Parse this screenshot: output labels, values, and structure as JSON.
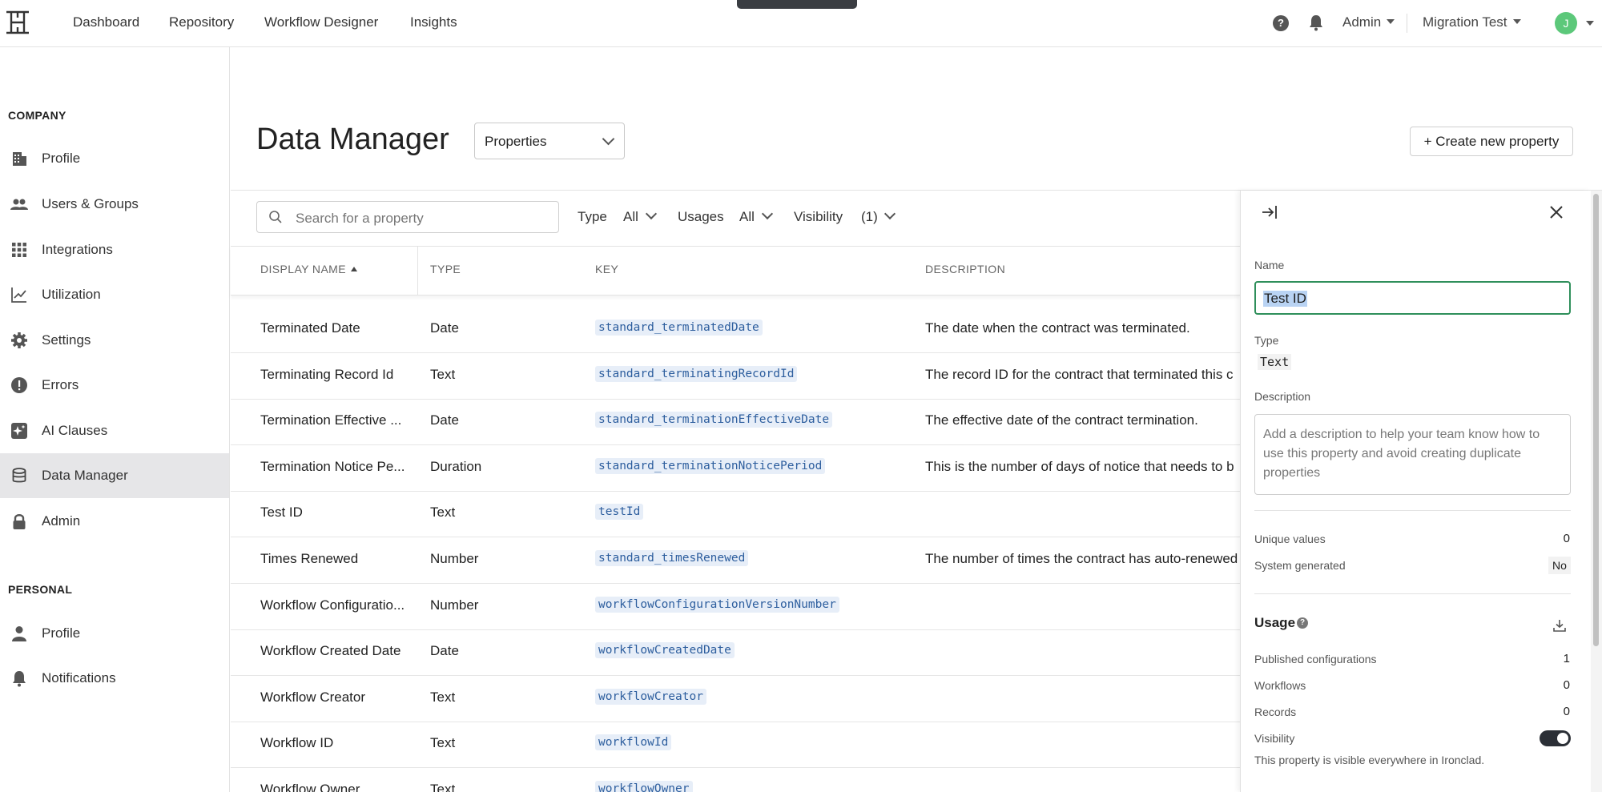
{
  "topnav": {
    "links": [
      "Dashboard",
      "Repository",
      "Workflow Designer",
      "Insights"
    ],
    "help_icon": "?",
    "admin_label": "Admin",
    "workspace_label": "Migration Test",
    "avatar_initial": "J"
  },
  "sidebar": {
    "company_title": "COMPANY",
    "company_items": [
      {
        "label": "Profile",
        "icon": "building-icon"
      },
      {
        "label": "Users & Groups",
        "icon": "users-icon"
      },
      {
        "label": "Integrations",
        "icon": "grid-icon"
      },
      {
        "label": "Utilization",
        "icon": "chart-line-icon"
      },
      {
        "label": "Settings",
        "icon": "gear-icon"
      },
      {
        "label": "Errors",
        "icon": "alert-circle-icon"
      },
      {
        "label": "AI Clauses",
        "icon": "sparkle-icon"
      },
      {
        "label": "Data Manager",
        "icon": "database-icon",
        "active": true
      },
      {
        "label": "Admin",
        "icon": "lock-icon"
      }
    ],
    "personal_title": "PERSONAL",
    "personal_items": [
      {
        "label": "Profile",
        "icon": "person-icon"
      },
      {
        "label": "Notifications",
        "icon": "bell-icon"
      }
    ]
  },
  "main": {
    "title": "Data Manager",
    "view_select": "Properties",
    "create_button": "+ Create new property",
    "search_placeholder": "Search for a property",
    "filters": {
      "type_label": "Type",
      "type_value": "All",
      "usages_label": "Usages",
      "usages_value": "All",
      "visibility_label": "Visibility",
      "visibility_value": "(1)"
    },
    "columns": [
      "DISPLAY NAME",
      "TYPE",
      "KEY",
      "DESCRIPTION"
    ],
    "rows": [
      {
        "name": "Terminated Date",
        "type": "Date",
        "key": "standard_terminatedDate",
        "description": "The date when the contract was terminated."
      },
      {
        "name": "Terminating Record Id",
        "type": "Text",
        "key": "standard_terminatingRecordId",
        "description": "The record ID for the contract that terminated this c"
      },
      {
        "name": "Termination Effective ...",
        "type": "Date",
        "key": "standard_terminationEffectiveDate",
        "description": "The effective date of the contract termination."
      },
      {
        "name": "Termination Notice Pe...",
        "type": "Duration",
        "key": "standard_terminationNoticePeriod",
        "description": "This is the number of days of notice that needs to b"
      },
      {
        "name": "Test ID",
        "type": "Text",
        "key": "testId",
        "description": ""
      },
      {
        "name": "Times Renewed",
        "type": "Number",
        "key": "standard_timesRenewed",
        "description": "The number of times the contract has auto-renewed"
      },
      {
        "name": "Workflow Configuratio...",
        "type": "Number",
        "key": "workflowConfigurationVersionNumber",
        "description": ""
      },
      {
        "name": "Workflow Created Date",
        "type": "Date",
        "key": "workflowCreatedDate",
        "description": ""
      },
      {
        "name": "Workflow Creator",
        "type": "Text",
        "key": "workflowCreator",
        "description": ""
      },
      {
        "name": "Workflow ID",
        "type": "Text",
        "key": "workflowId",
        "description": ""
      },
      {
        "name": "Workflow Owner",
        "type": "Text",
        "key": "workflowOwner",
        "description": ""
      }
    ]
  },
  "panel": {
    "name_label": "Name",
    "name_value": "Test ID",
    "type_label": "Type",
    "type_value": "Text",
    "description_label": "Description",
    "description_placeholder": "Add a description to help your team know how to use this property and avoid creating duplicate properties",
    "unique_values_label": "Unique values",
    "unique_values": "0",
    "system_generated_label": "System generated",
    "system_generated": "No",
    "usage_title": "Usage",
    "published_configurations_label": "Published configurations",
    "published_configurations": "1",
    "workflows_label": "Workflows",
    "workflows": "0",
    "records_label": "Records",
    "records": "0",
    "visibility_label": "Visibility",
    "visibility_on": true,
    "visibility_note": "This property is visible everywhere in Ironclad."
  }
}
